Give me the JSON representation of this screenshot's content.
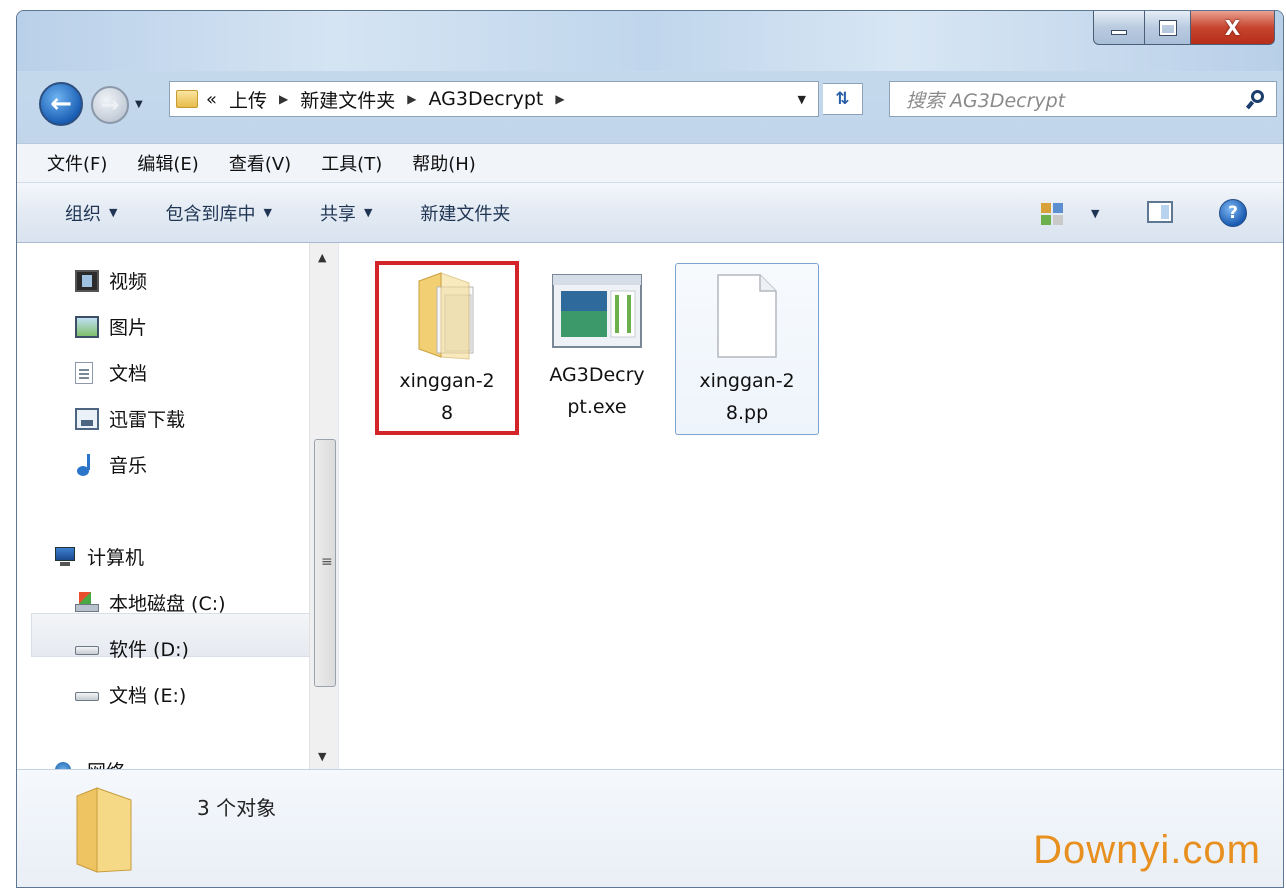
{
  "window": {
    "title": "",
    "controls": {
      "minimize": "—",
      "maximize": "□",
      "close": "X"
    }
  },
  "navigation": {
    "back_icon": "back-arrow-icon",
    "forward_icon": "forward-arrow-icon",
    "overflow": "«",
    "breadcrumbs": [
      "上传",
      "新建文件夹",
      "AG3Decrypt"
    ],
    "search_placeholder": "搜索 AG3Decrypt"
  },
  "menubar": {
    "items": [
      "文件(F)",
      "编辑(E)",
      "查看(V)",
      "工具(T)",
      "帮助(H)"
    ]
  },
  "toolbar": {
    "items": [
      {
        "label": "组织",
        "dropdown": true
      },
      {
        "label": "包含到库中",
        "dropdown": true
      },
      {
        "label": "共享",
        "dropdown": true
      },
      {
        "label": "新建文件夹",
        "dropdown": false
      }
    ]
  },
  "sidebar": {
    "items": [
      {
        "label": "视频",
        "icon": "video-library-icon"
      },
      {
        "label": "图片",
        "icon": "pictures-library-icon"
      },
      {
        "label": "文档",
        "icon": "documents-library-icon"
      },
      {
        "label": "迅雷下载",
        "icon": "download-folder-icon"
      },
      {
        "label": "音乐",
        "icon": "music-note-icon"
      },
      {
        "label": "计算机",
        "icon": "computer-icon"
      },
      {
        "label": "本地磁盘 (C:)",
        "icon": "system-drive-icon"
      },
      {
        "label": "软件 (D:)",
        "icon": "hard-drive-icon"
      },
      {
        "label": "文档 (E:)",
        "icon": "hard-drive-icon"
      },
      {
        "label": "网络",
        "icon": "network-icon"
      }
    ],
    "selected": "软件 (D:)"
  },
  "files": [
    {
      "name": "xinggan-28",
      "line1": "xinggan-2",
      "line2": "8",
      "type": "folder",
      "highlighted": true
    },
    {
      "name": "AG3Decrypt.exe",
      "line1": "AG3Decry",
      "line2": "pt.exe",
      "type": "application"
    },
    {
      "name": "xinggan-28.pp",
      "line1": "xinggan-2",
      "line2": "8.pp",
      "type": "file",
      "selected": true
    }
  ],
  "status": {
    "count_text": "3 个对象"
  },
  "watermark": "Downyi.com",
  "colors": {
    "highlight_border": "#d3242a",
    "watermark": "#e8901f",
    "selection": "#7da2ce"
  }
}
